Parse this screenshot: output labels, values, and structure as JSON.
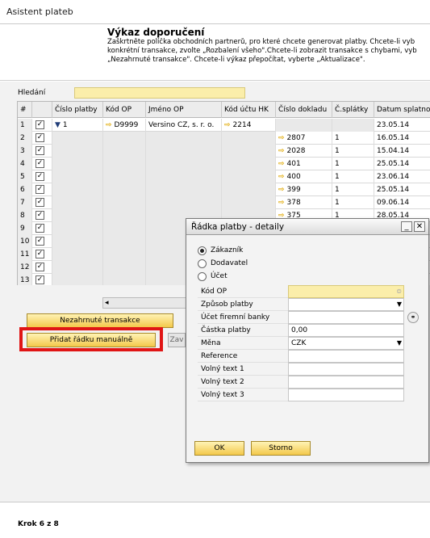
{
  "window": {
    "title": "Asistent plateb"
  },
  "header": {
    "title": "Výkaz doporučení",
    "description": "Zaškrtněte políčka obchodních partnerů, pro které chcete generovat platby. Chcete-li vyb\nkonkrétní transakce, zvolte „Rozbalení všeho\".Chcete-li zobrazit transakce s chybami, vyb\n„Nezahrnuté transakce\". Chcete-li výkaz přepočítat, vyberte „Aktualizace\"."
  },
  "search": {
    "label": "Hledání",
    "value": ""
  },
  "grid": {
    "columns": [
      "#",
      "",
      "Číslo platby",
      "Kód OP",
      "Jméno OP",
      "Kód účtu HK",
      "Číslo dokladu",
      "Č.splátky",
      "Datum splatno"
    ],
    "rows": [
      {
        "num": "1",
        "checked": true,
        "payment_no": "1",
        "bp_code": "D9999",
        "bp_name": "Versino CZ, s. r. o.",
        "gl_code": "2214",
        "doc_no": "",
        "installment": "",
        "due_date": "23.05.14"
      },
      {
        "num": "2",
        "checked": true,
        "payment_no": "",
        "bp_code": "",
        "bp_name": "",
        "gl_code": "",
        "doc_no": "2807",
        "installment": "1",
        "due_date": "16.05.14"
      },
      {
        "num": "3",
        "checked": true,
        "payment_no": "",
        "bp_code": "",
        "bp_name": "",
        "gl_code": "",
        "doc_no": "2028",
        "installment": "1",
        "due_date": "15.04.14"
      },
      {
        "num": "4",
        "checked": true,
        "payment_no": "",
        "bp_code": "",
        "bp_name": "",
        "gl_code": "",
        "doc_no": "401",
        "installment": "1",
        "due_date": "25.05.14"
      },
      {
        "num": "5",
        "checked": true,
        "payment_no": "",
        "bp_code": "",
        "bp_name": "",
        "gl_code": "",
        "doc_no": "400",
        "installment": "1",
        "due_date": "23.06.14"
      },
      {
        "num": "6",
        "checked": true,
        "payment_no": "",
        "bp_code": "",
        "bp_name": "",
        "gl_code": "",
        "doc_no": "399",
        "installment": "1",
        "due_date": "25.05.14"
      },
      {
        "num": "7",
        "checked": true,
        "payment_no": "",
        "bp_code": "",
        "bp_name": "",
        "gl_code": "",
        "doc_no": "378",
        "installment": "1",
        "due_date": "09.06.14"
      },
      {
        "num": "8",
        "checked": true,
        "payment_no": "",
        "bp_code": "",
        "bp_name": "",
        "gl_code": "",
        "doc_no": "375",
        "installment": "1",
        "due_date": "28.05.14"
      },
      {
        "num": "9",
        "checked": true,
        "payment_no": "",
        "bp_code": "",
        "bp_name": "",
        "gl_code": "",
        "doc_no": "",
        "installment": "",
        "due_date": ""
      },
      {
        "num": "10",
        "checked": true,
        "payment_no": "",
        "bp_code": "",
        "bp_name": "",
        "gl_code": "",
        "doc_no": "",
        "installment": "",
        "due_date": ""
      },
      {
        "num": "11",
        "checked": true,
        "payment_no": "",
        "bp_code": "",
        "bp_name": "",
        "gl_code": "",
        "doc_no": "",
        "installment": "",
        "due_date": ""
      },
      {
        "num": "12",
        "checked": true,
        "payment_no": "",
        "bp_code": "",
        "bp_name": "",
        "gl_code": "",
        "doc_no": "",
        "installment": "",
        "due_date": ""
      },
      {
        "num": "13",
        "checked": true,
        "payment_no": "",
        "bp_code": "",
        "bp_name": "",
        "gl_code": "",
        "doc_no": "",
        "installment": "",
        "due_date": ""
      }
    ]
  },
  "buttons": {
    "excluded": "Nezahrnuté transakce",
    "add_manual": "Přidat řádku manuálně",
    "partial": "Zav"
  },
  "dialog": {
    "title": "Řádka platby - detaily",
    "radios": [
      {
        "label": "Zákazník",
        "selected": true
      },
      {
        "label": "Dodavatel",
        "selected": false
      },
      {
        "label": "Účet",
        "selected": false
      }
    ],
    "fields": [
      {
        "label": "Kód OP",
        "value": ""
      },
      {
        "label": "Způsob platby",
        "value": ""
      },
      {
        "label": "Účet firemní banky",
        "value": ""
      },
      {
        "label": "Částka platby",
        "value": "0,00"
      },
      {
        "label": "Měna",
        "value": "CZK"
      },
      {
        "label": "Reference",
        "value": ""
      },
      {
        "label": "Volný text 1",
        "value": ""
      },
      {
        "label": "Volný text 2",
        "value": ""
      },
      {
        "label": "Volný text 3",
        "value": ""
      }
    ],
    "ok": "OK",
    "cancel": "Storno"
  },
  "footer": {
    "step": "Krok 6 z 8"
  },
  "colors": {
    "accent_yellow": "#f3c84a",
    "highlight_red": "#e01515",
    "field_yellow": "#fbeeaa"
  }
}
